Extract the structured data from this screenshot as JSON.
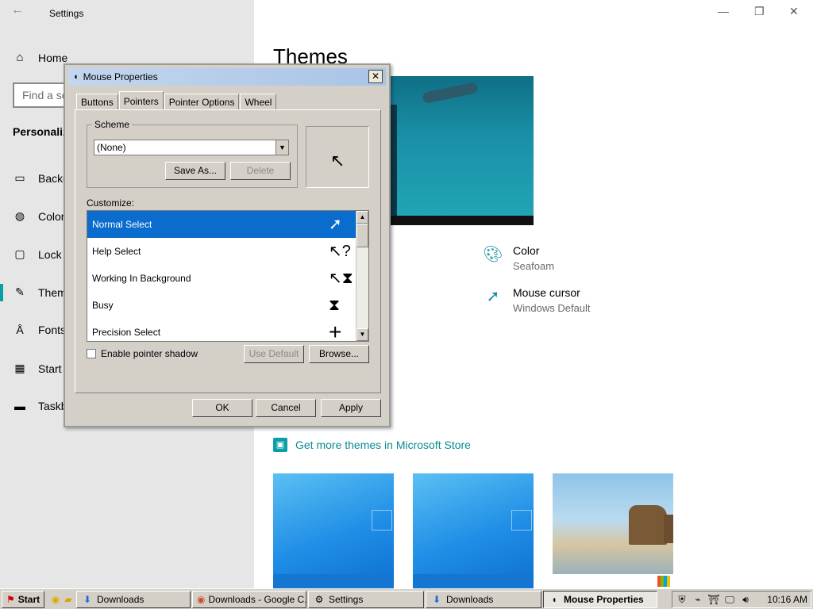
{
  "settings": {
    "title": "Settings",
    "home_label": "Home",
    "search_placeholder": "Find a se",
    "section_heading": "Personaliz",
    "nav": [
      {
        "label": "Backg",
        "icon": "image-icon"
      },
      {
        "label": "Colors",
        "icon": "palette-icon"
      },
      {
        "label": "Lock",
        "icon": "lock-screen-icon"
      },
      {
        "label": "Them",
        "icon": "themes-icon"
      },
      {
        "label": "Fonts",
        "icon": "fonts-icon"
      },
      {
        "label": "Start",
        "icon": "start-icon"
      },
      {
        "label": "Taskb",
        "icon": "taskbar-icon"
      }
    ],
    "page_title": "Themes",
    "color_label": "Color",
    "color_value": "Seafoam",
    "cursor_label": "Mouse cursor",
    "cursor_value": "Windows Default",
    "store_link": "Get more themes in Microsoft Store",
    "accent_color": "#0a9fa6"
  },
  "dialog": {
    "title": "Mouse Properties",
    "tabs": [
      "Buttons",
      "Pointers",
      "Pointer Options",
      "Wheel"
    ],
    "active_tab": "Pointers",
    "scheme_legend": "Scheme",
    "scheme_value": "(None)",
    "save_as": "Save As...",
    "delete": "Delete",
    "customize_label": "Customize:",
    "pointers": [
      {
        "name": "Normal Select",
        "glyph": "➚"
      },
      {
        "name": "Help Select",
        "glyph": "↖?"
      },
      {
        "name": "Working In Background",
        "glyph": "↖⧗"
      },
      {
        "name": "Busy",
        "glyph": "⧗"
      },
      {
        "name": "Precision Select",
        "glyph": "+"
      }
    ],
    "shadow_label": "Enable pointer shadow",
    "use_default": "Use Default",
    "browse": "Browse...",
    "ok": "OK",
    "cancel": "Cancel",
    "apply": "Apply"
  },
  "taskbar": {
    "start": "Start",
    "items": [
      "Downloads",
      "Downloads - Google C...",
      "Settings",
      "Downloads",
      "Mouse Properties"
    ],
    "clock": "10:16 AM"
  }
}
